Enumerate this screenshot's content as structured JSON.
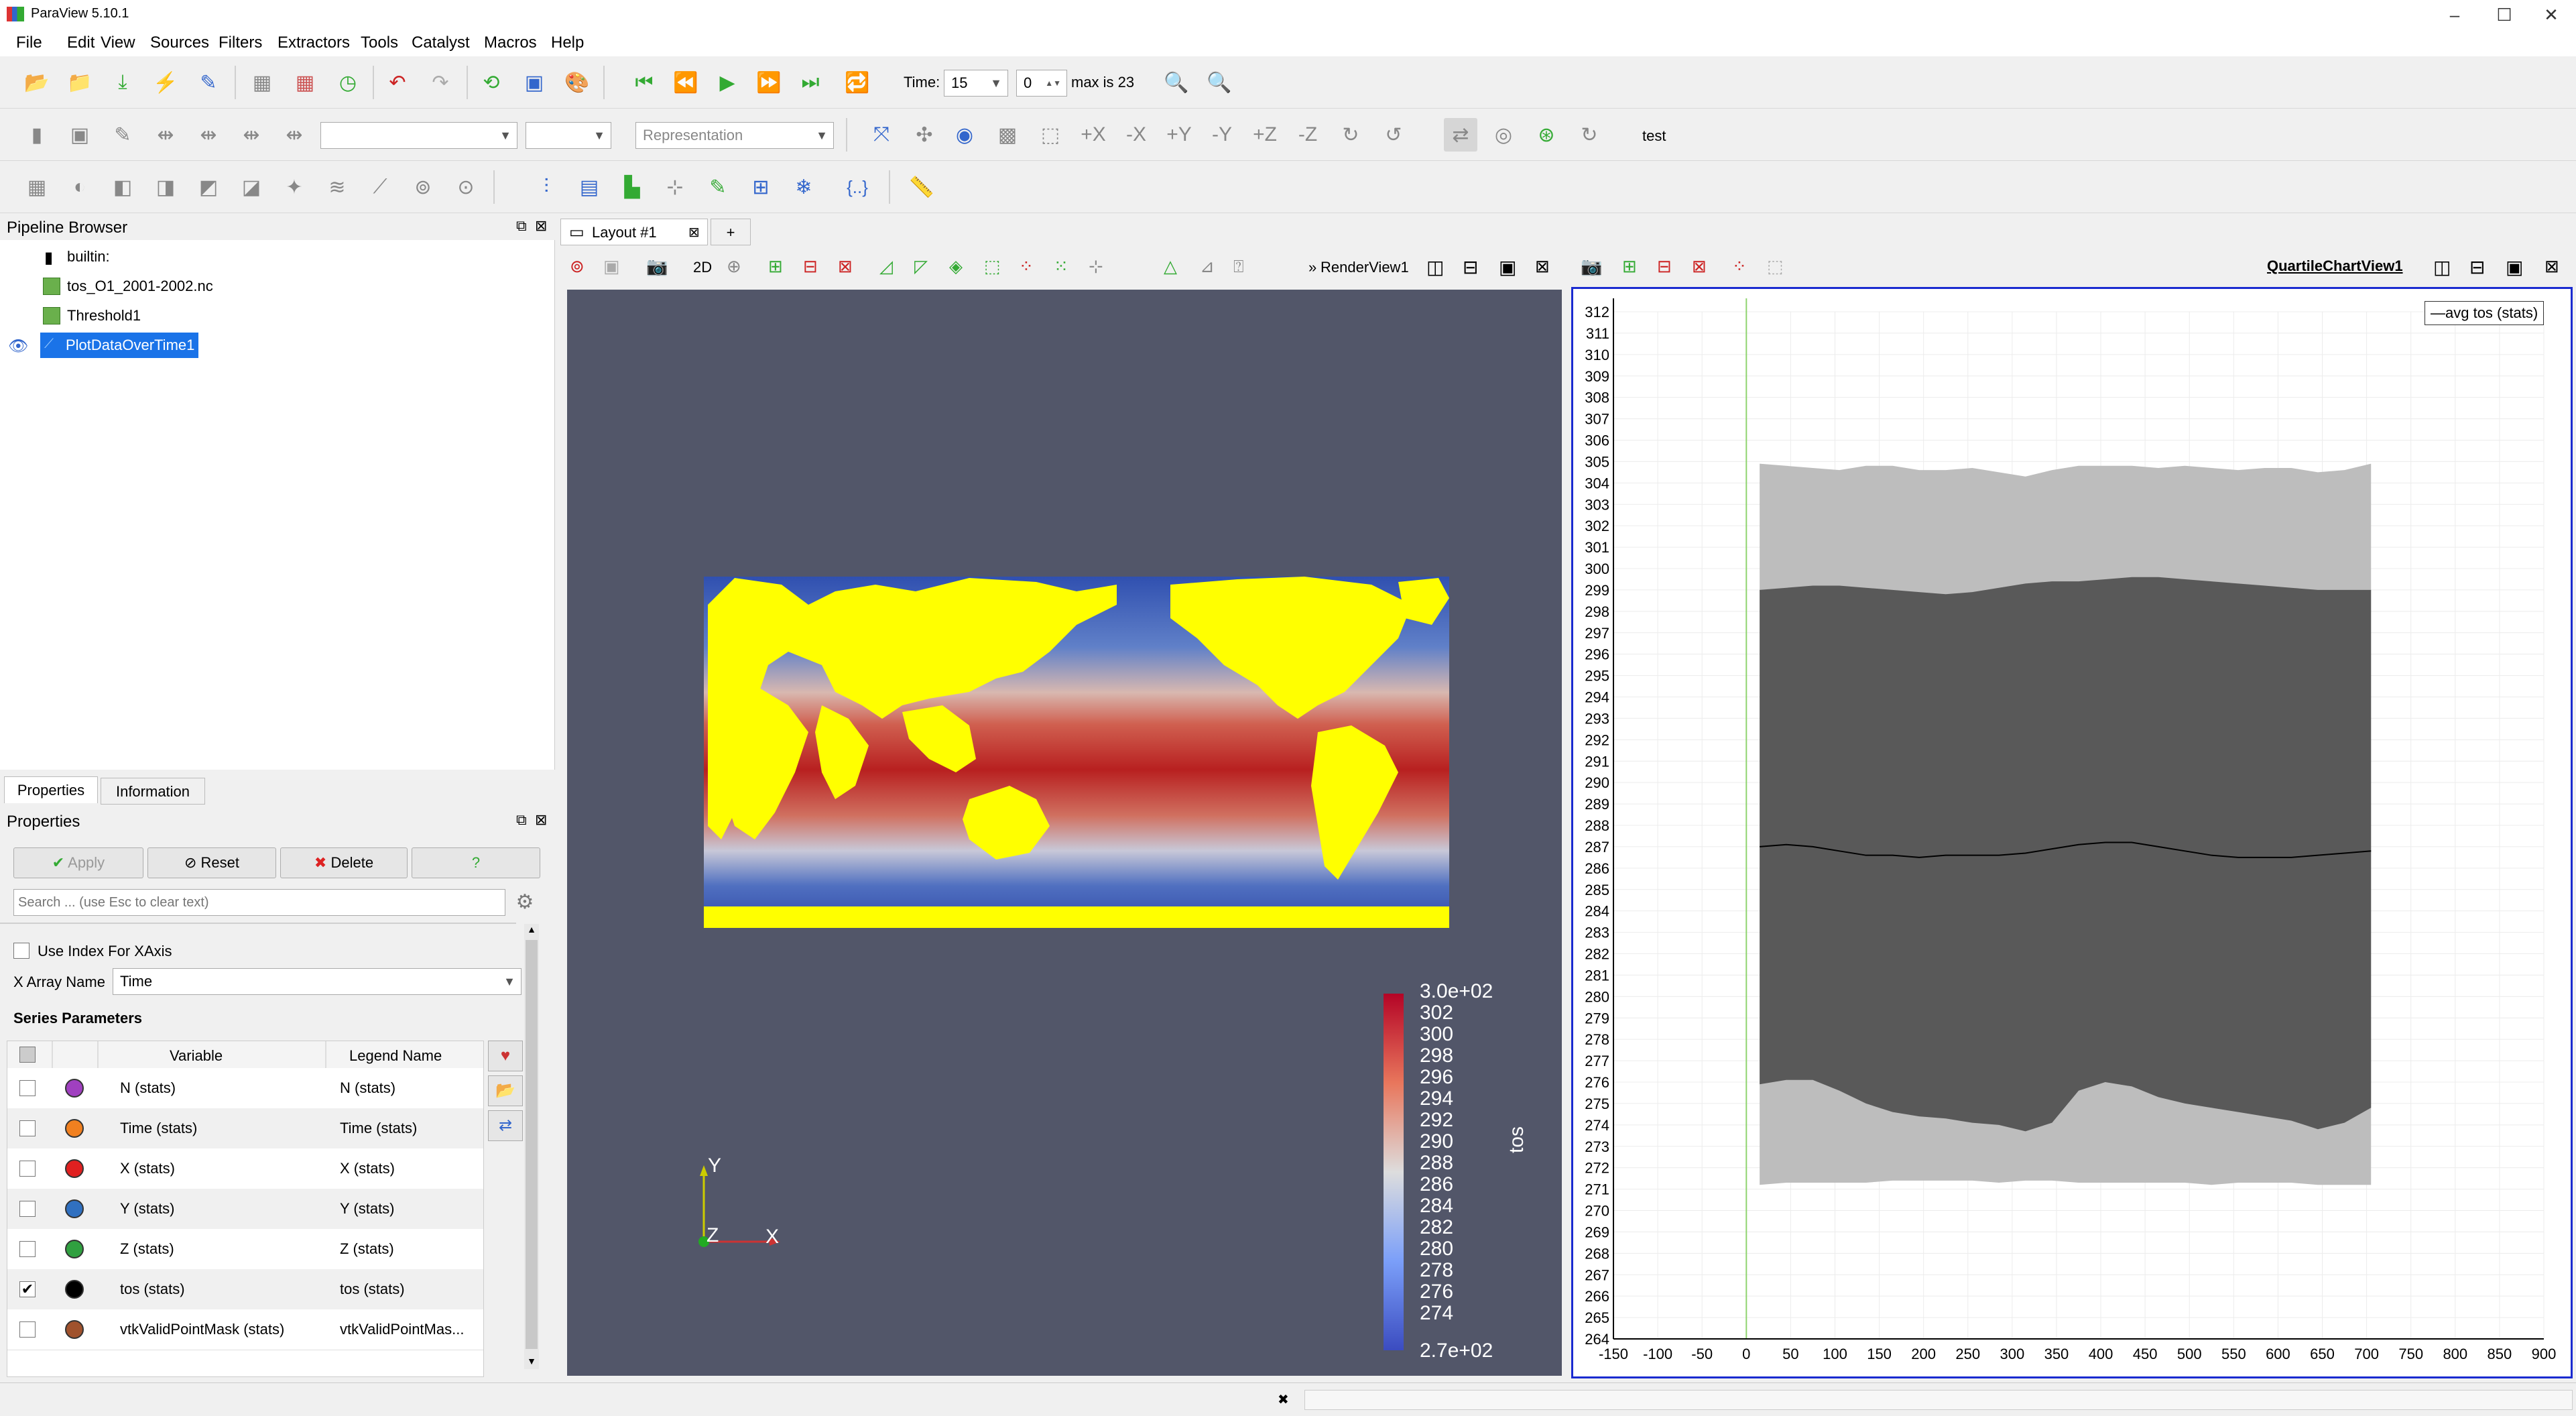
{
  "window": {
    "title": "ParaView 5.10.1"
  },
  "menu": [
    "File",
    "Edit",
    "View",
    "Sources",
    "Filters",
    "Extractors",
    "Tools",
    "Catalyst",
    "Macros",
    "Help"
  ],
  "time_toolbar": {
    "time_label": "Time:",
    "time_value": "15",
    "index_value": "0",
    "max_text": "max is 23"
  },
  "representation_placeholder": "Representation",
  "test_label": "test",
  "pipeline": {
    "title": "Pipeline Browser",
    "items": [
      "builtin:",
      "tos_O1_2001-2002.nc",
      "Threshold1",
      "PlotDataOverTime1"
    ]
  },
  "tabs": {
    "properties": "Properties",
    "information": "Information"
  },
  "properties": {
    "title": "Properties",
    "apply": "Apply",
    "reset": "Reset",
    "delete": "Delete",
    "help": "?",
    "search_placeholder": "Search ... (use Esc to clear text)",
    "use_index_label": "Use Index For XAxis",
    "x_array_label": "X Array Name",
    "x_array_value": "Time",
    "series_title": "Series Parameters",
    "col_variable": "Variable",
    "col_legend": "Legend Name",
    "series": [
      {
        "variable": "N (stats)",
        "legend": "N (stats)",
        "color": "#a040c0",
        "checked": false
      },
      {
        "variable": "Time (stats)",
        "legend": "Time (stats)",
        "color": "#f08020",
        "checked": false
      },
      {
        "variable": "X (stats)",
        "legend": "X (stats)",
        "color": "#e02020",
        "checked": false
      },
      {
        "variable": "Y (stats)",
        "legend": "Y (stats)",
        "color": "#3070c0",
        "checked": false
      },
      {
        "variable": "Z (stats)",
        "legend": "Z (stats)",
        "color": "#30a040",
        "checked": false
      },
      {
        "variable": "tos (stats)",
        "legend": "tos (stats)",
        "color": "#000000",
        "checked": true
      },
      {
        "variable": "vtkValidPointMask (stats)",
        "legend": "vtkValidPointMas...",
        "color": "#a0522d",
        "checked": false
      }
    ]
  },
  "layout": {
    "tab_label": "Layout #1",
    "add_tab": "+"
  },
  "render_view": {
    "name": "RenderView1",
    "mode_2d": "2D",
    "colorbar": {
      "title": "tos",
      "top": "3.0e+02",
      "bottom": "2.7e+02",
      "labels": [
        "302",
        "300",
        "298",
        "296",
        "294",
        "292",
        "290",
        "288",
        "286",
        "284",
        "282",
        "280",
        "278",
        "276",
        "274"
      ]
    },
    "axes": {
      "y": "Y",
      "z": "Z",
      "x": "X"
    }
  },
  "chart_view": {
    "name": "QuartileChartView1"
  },
  "chart_data": {
    "type": "area",
    "legend": "avg tos (stats)",
    "legend_position": "top-right",
    "xlim": [
      -150,
      900
    ],
    "ylim": [
      264,
      312
    ],
    "x_ticks": [
      -150,
      -100,
      -50,
      0,
      50,
      100,
      150,
      200,
      250,
      300,
      350,
      400,
      450,
      500,
      550,
      600,
      650,
      700,
      750,
      800,
      850,
      900
    ],
    "y_ticks": [
      264,
      265,
      266,
      267,
      268,
      269,
      270,
      271,
      272,
      273,
      274,
      275,
      276,
      277,
      278,
      279,
      280,
      281,
      282,
      283,
      284,
      285,
      286,
      287,
      288,
      289,
      290,
      291,
      292,
      293,
      294,
      295,
      296,
      297,
      298,
      299,
      300,
      301,
      302,
      303,
      304,
      305,
      306,
      307,
      308,
      309,
      310,
      311,
      312
    ],
    "x": [
      15,
      45,
      75,
      105,
      135,
      165,
      195,
      225,
      255,
      285,
      315,
      345,
      375,
      405,
      435,
      465,
      495,
      525,
      555,
      585,
      615,
      645,
      675,
      705
    ],
    "series": [
      {
        "name": "max",
        "values": [
          304.9,
          304.8,
          304.7,
          304.6,
          304.8,
          304.8,
          304.6,
          304.6,
          304.7,
          304.5,
          304.3,
          304.6,
          304.8,
          304.8,
          304.8,
          304.7,
          304.8,
          304.7,
          304.6,
          304.7,
          304.7,
          304.5,
          304.6,
          304.9
        ]
      },
      {
        "name": "q3",
        "values": [
          299.0,
          299.1,
          299.2,
          299.2,
          299.1,
          299.0,
          298.9,
          298.8,
          298.9,
          299.1,
          299.3,
          299.4,
          299.4,
          299.5,
          299.6,
          299.6,
          299.5,
          299.4,
          299.3,
          299.2,
          299.1,
          299.0,
          299.0,
          299.0
        ]
      },
      {
        "name": "avg tos (stats)",
        "values": [
          287.0,
          287.1,
          287.0,
          286.8,
          286.6,
          286.6,
          286.5,
          286.6,
          286.6,
          286.6,
          286.7,
          286.9,
          287.1,
          287.2,
          287.2,
          287.0,
          286.8,
          286.6,
          286.5,
          286.5,
          286.5,
          286.6,
          286.7,
          286.8
        ]
      },
      {
        "name": "q1",
        "values": [
          275.9,
          276.1,
          276.1,
          275.6,
          275.0,
          274.6,
          274.4,
          274.3,
          274.1,
          274.0,
          273.7,
          274.1,
          275.6,
          276.0,
          275.8,
          275.3,
          275.0,
          274.8,
          274.6,
          274.4,
          274.2,
          273.8,
          274.1,
          274.8
        ]
      },
      {
        "name": "min",
        "values": [
          271.2,
          271.3,
          271.3,
          271.3,
          271.3,
          271.4,
          271.4,
          271.4,
          271.4,
          271.3,
          271.4,
          271.4,
          271.3,
          271.3,
          271.3,
          271.3,
          271.3,
          271.2,
          271.3,
          271.3,
          271.3,
          271.2,
          271.2,
          271.2
        ]
      }
    ]
  }
}
